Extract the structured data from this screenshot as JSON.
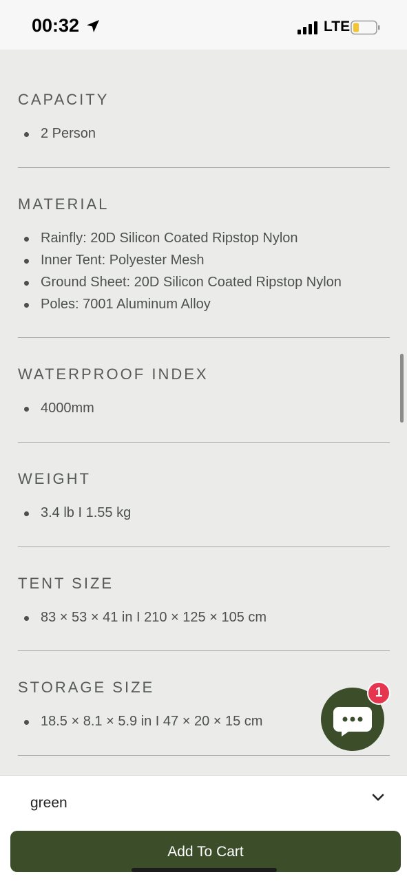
{
  "status_bar": {
    "time": "00:32",
    "network": "LTE",
    "icons": [
      "location-arrow-icon",
      "signal-icon",
      "battery-icon"
    ]
  },
  "specs": [
    {
      "title": "CAPACITY",
      "items": [
        "2 Person"
      ]
    },
    {
      "title": "MATERIAL",
      "items": [
        "Rainfly: 20D Silicon Coated Ripstop Nylon",
        "Inner Tent: Polyester Mesh",
        "Ground Sheet: 20D Silicon Coated Ripstop Nylon",
        "Poles: 7001 Aluminum Alloy"
      ]
    },
    {
      "title": "WATERPROOF INDEX",
      "items": [
        "4000mm"
      ]
    },
    {
      "title": "WEIGHT",
      "items": [
        "3.4 lb I 1.55 kg"
      ]
    },
    {
      "title": "TENT SIZE",
      "items": [
        "83 × 53 × 41 in I 210 × 125 × 105 cm"
      ]
    },
    {
      "title": "STORAGE SIZE",
      "items": [
        "18.5 × 8.1 × 5.9 in I 47 × 20 × 15 cm"
      ]
    }
  ],
  "chat": {
    "badge_count": "1",
    "icon": "chat-bubble-icon"
  },
  "variant": {
    "selected": "green",
    "icon": "chevron-down-icon"
  },
  "actions": {
    "add_to_cart": "Add To Cart"
  },
  "colors": {
    "brand_green": "#3c4d2a",
    "badge_red": "#e5354f",
    "background": "#ebecea"
  }
}
